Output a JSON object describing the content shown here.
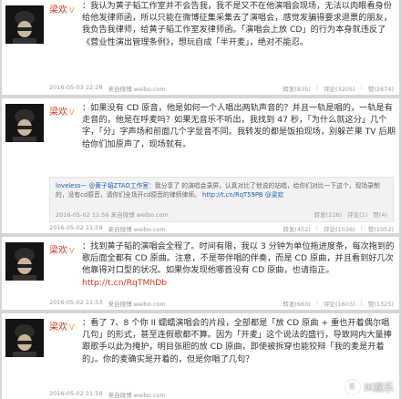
{
  "posts": [
    {
      "author": "梁欢",
      "v_badge": "V",
      "text_before": "：我认为黄子韬工作室并不会告我，我不是又不在他演唱会现场，无法以肉眼看身份给他发律师函，所以只能在微博征集采集去了演唱会，感觉发骗得要求退票的朋友，我负告我律师，给黄子韬工作室发律师函。「演唱会上放 CD」的行为本身就违反了《营业性演出管理条例》，想玩自成「半开麦」，绝对不能忍。",
      "time": "2016-05-03 22:28",
      "source": "来自微博 weibo.com",
      "actions": [
        "转发(835)",
        "评论(3205)",
        "赞(2874)"
      ]
    },
    {
      "author": "梁欢",
      "v_badge": "V",
      "text_before": "：如果没有 CD 原音，他是如何一个人唱出两轨声音的？并且一轨是唱的，一轨是有走音的，他是在呼麦吗？如果无音乐不听出，我找到 47 秒，「为什么就这分」几个字，「分」字声场和前面几个字显音不同。我转发的都是饭拍现场，别躲芒果 TV 后期给你们加原声了，现场就有。",
      "quote": {
        "name": "loveless—",
        "mention": "@黄子韬ZTAO工作室",
        "body": "：我分享了 的演唱会录屏，认真对比了他说的站唱，给你们对比一下这个，现场录制的，没有cd原音，请你们全场开cd原音的律师律师。",
        "link": "http://t.cn/RqT59PB",
        "at_name": "@梁欢",
        "time": "2016-05-02 11:56",
        "source": "来自微博 weibo.com",
        "actions": [
          "转发(226)",
          "评论(1)",
          "赞(4)"
        ]
      },
      "time": "2016-05-02 11:59",
      "source": "来自微博 weibo.com",
      "actions": [
        "转发(452)",
        "评论(1036)",
        "赞(1052)"
      ]
    },
    {
      "author": "梁欢",
      "v_badge": "V",
      "text_before": "：找到黄子韬的演唱会全程了。时间有限，我以 3 分钟为单位拖进度条，每次拖到的歌后面全都有 CD 原曲。注意，不是带伴唱的伴奏，而是 CD 原曲，并且看到好几次他靠得对口型的状况。如果你发现他哪首没有 CD 原曲，也请指正。",
      "link": "http://t.cn/RqTMhDb",
      "time": "2016-05-02 11:53",
      "source": "来自微博 weibo.com",
      "actions": [
        "转发(663)",
        "评论(1603)",
        "赞(1325)"
      ]
    },
    {
      "author": "梁欢",
      "v_badge": "V",
      "text_before": "：看了 7、8 个你 II 蠕蠕演唱会的片段，全部都是「放 CD 原曲 + 重也开着偶尔唱几句」的形式，甚至连假歌都不算。因为「开麦」这个说法的盛行，导致网内大量捧跟歌手以此为掩护，明目张胆的放 CD 原曲，即使被拆穿也能狡辩「我的麦是开着的」。你的麦确实是开着的，但是你唱了几句？",
      "time": "2016-05-02 11:59",
      "source": "来自微博 weibo.com",
      "actions": [
        "转发(472)",
        "评论(1216)",
        "赞(1051)"
      ]
    }
  ],
  "watermark": {
    "logo": "K",
    "text": "IK娱乐"
  }
}
